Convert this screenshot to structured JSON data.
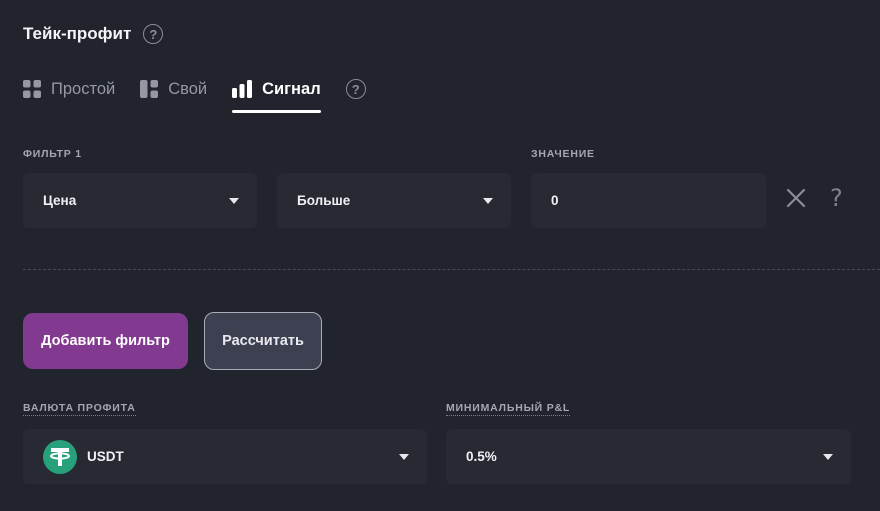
{
  "header": {
    "title": "Тейк-профит",
    "help_icon": "question-circle-icon"
  },
  "tabs": [
    {
      "label": "Простой",
      "icon": "grid-icon",
      "active": false
    },
    {
      "label": "Свой",
      "icon": "layout-icon",
      "active": false
    },
    {
      "label": "Сигнал",
      "icon": "signal-bars-icon",
      "active": true
    }
  ],
  "filter": {
    "label": "ФИЛЬТР 1",
    "value_label": "ЗНАЧЕНИЕ",
    "type_value": "Цена",
    "condition_value": "Больше",
    "number_value": "0",
    "remove_icon": "close-icon",
    "help_symbol": "?"
  },
  "buttons": {
    "add_filter": "Добавить фильтр",
    "calculate": "Рассчитать"
  },
  "profit_currency": {
    "label": "ВАЛЮТА ПРОФИТА",
    "value": "USDT",
    "icon": "tether-icon"
  },
  "min_pnl": {
    "label": "МИНИМАЛЬНЫЙ P&L",
    "value": "0.5%"
  },
  "colors": {
    "background": "#21232d",
    "field": "#282a33",
    "accent": "#823a90",
    "tether": "#26a17b"
  }
}
